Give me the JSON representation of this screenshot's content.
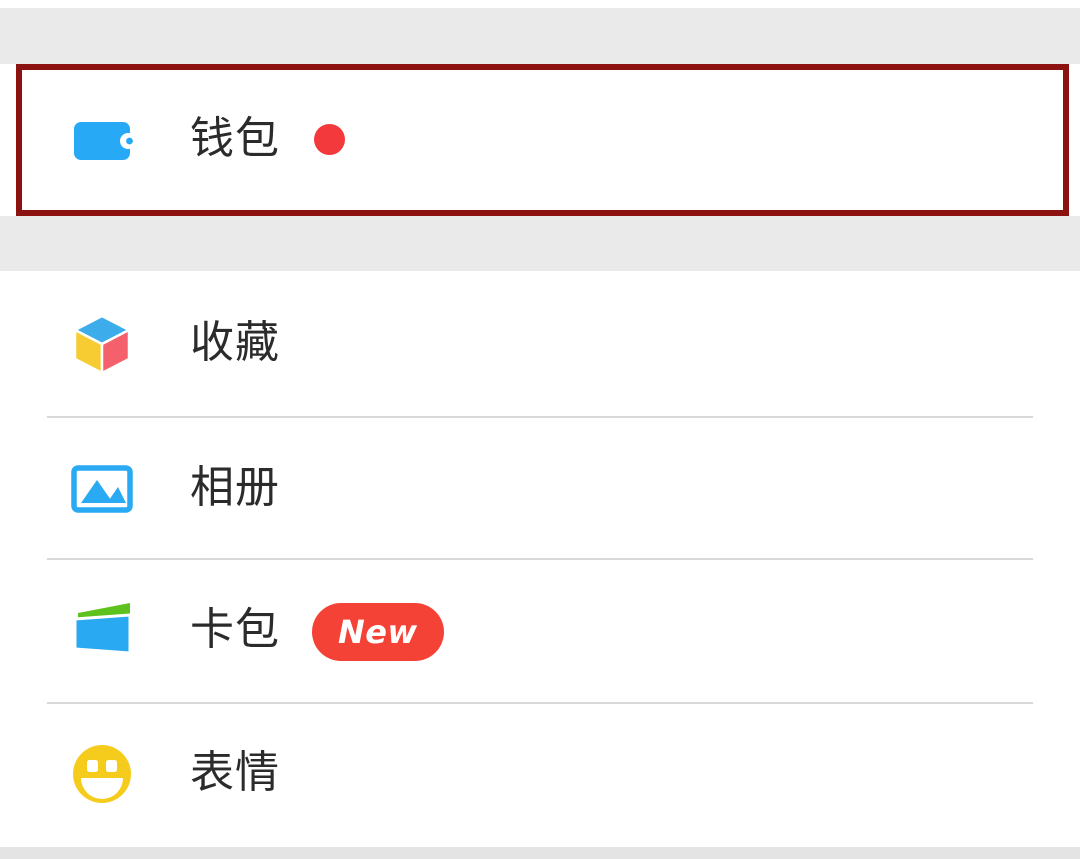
{
  "screen": {
    "title": "WeChat Me / Profile menu",
    "background_color": "#ffffff",
    "band_color": "#eaeaea",
    "separator_color": "#d9d9d9",
    "text_color": "#2b2b2b"
  },
  "highlight": {
    "name": "wallet-row-highlight",
    "color": "#8c1111",
    "border_width_px": 6
  },
  "wallet_section": {
    "item": {
      "label": "钱包",
      "icon": "wallet-icon",
      "icon_color": "#28a9f5",
      "badge": {
        "type": "red-dot",
        "color": "#f4393c"
      }
    }
  },
  "menu": {
    "items": [
      {
        "label": "收藏",
        "icon": "favorites-cube-icon",
        "icon_colors": {
          "top": "#3cacea",
          "left": "#f7cc33",
          "right": "#f4606c"
        },
        "badge": null
      },
      {
        "label": "相册",
        "icon": "album-photo-icon",
        "icon_colors": {
          "frame": "#29aaf3",
          "mountain": "#29aaf3"
        },
        "badge": null
      },
      {
        "label": "卡包",
        "icon": "cards-wallet-icon",
        "icon_colors": {
          "front": "#29a9f2",
          "back": "#5dc21e"
        },
        "badge": {
          "type": "pill",
          "text": "New",
          "background": "#f44336",
          "text_color": "#ffffff"
        }
      },
      {
        "label": "表情",
        "icon": "emoji-smiley-icon",
        "icon_colors": {
          "face": "#f6cc1c"
        },
        "badge": null
      }
    ]
  }
}
